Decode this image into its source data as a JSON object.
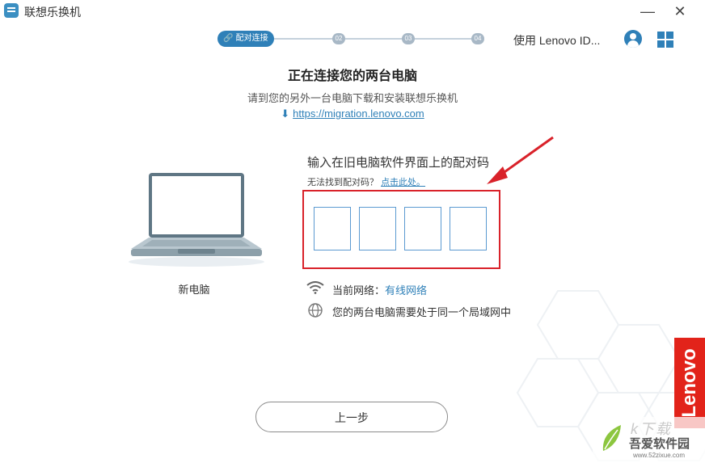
{
  "app": {
    "title": "联想乐换机"
  },
  "stepper": {
    "steps": [
      "配对连接",
      "02",
      "03",
      "04"
    ]
  },
  "header": {
    "lenovo_id": "使用 Lenovo ID..."
  },
  "main": {
    "title": "正在连接您的两台电脑",
    "subtitle": "请到您的另外一台电脑下载和安装联想乐换机",
    "download_url": "https://migration.lenovo.com"
  },
  "device": {
    "label": "新电脑"
  },
  "pairing": {
    "title": "输入在旧电脑软件界面上的配对码",
    "help_prefix": "无法找到配对码？",
    "help_link": "点击此处。",
    "code_values": [
      "",
      "",
      "",
      ""
    ]
  },
  "network": {
    "current_label": "当前网络：",
    "current_value": "有线网络",
    "note": "您的两台电脑需要处于同一个局域网中"
  },
  "footer": {
    "back_label": "上一步"
  },
  "brand": {
    "vertical_logo": "Lenovo",
    "color": "#e2231a"
  },
  "watermark": {
    "name": "吾爱软件园",
    "url": "www.52zixue.com"
  },
  "colors": {
    "accent": "#2f80b8",
    "highlight_box": "#d9222a"
  }
}
